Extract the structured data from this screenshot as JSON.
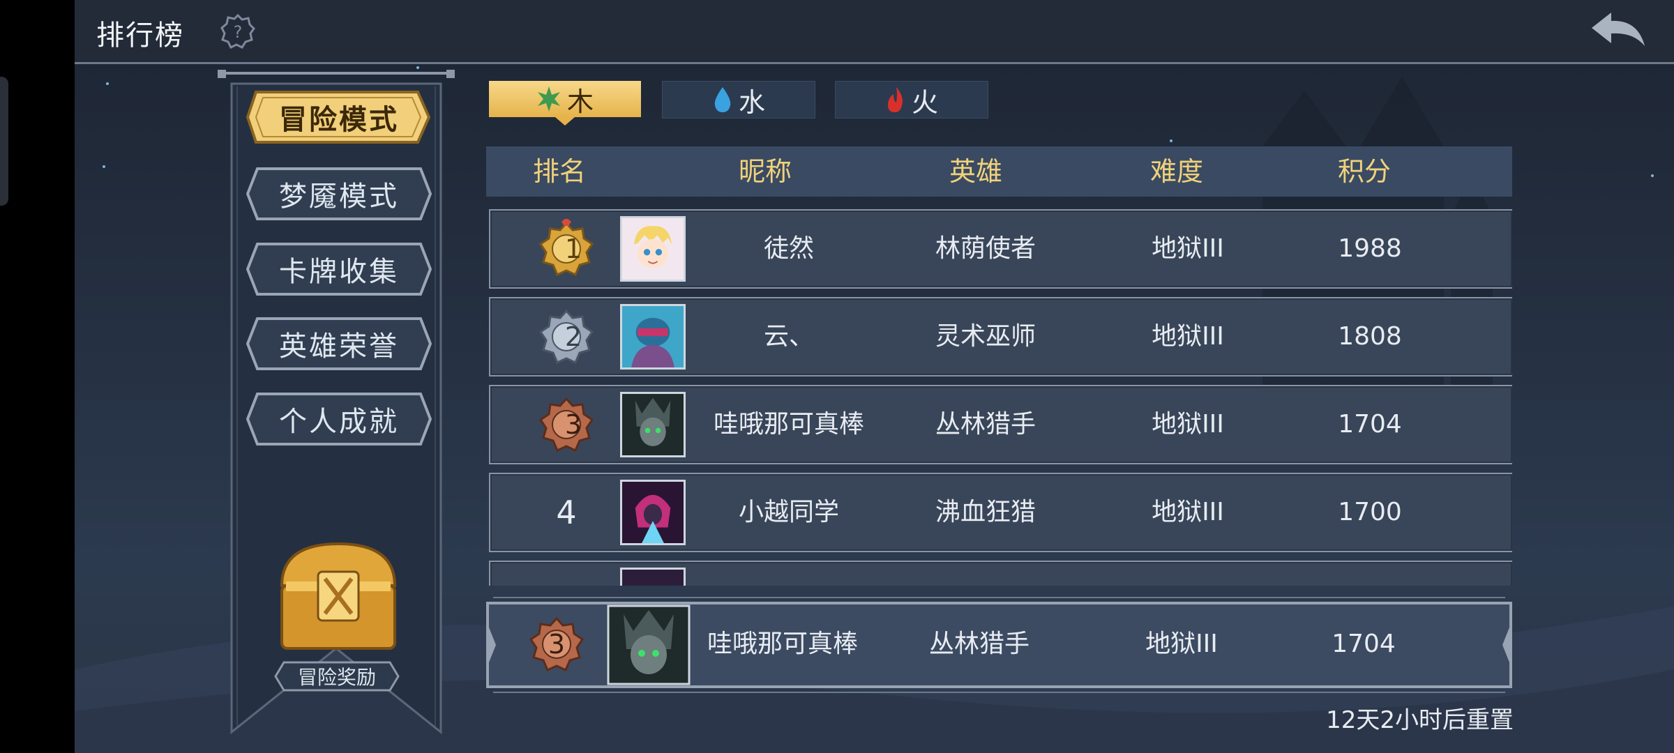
{
  "header": {
    "title": "排行榜",
    "help_icon": "help-gear-icon",
    "back_icon": "return-arrow-icon"
  },
  "modes": [
    {
      "label": "冒险模式",
      "active": true
    },
    {
      "label": "梦魇模式",
      "active": false
    },
    {
      "label": "卡牌收集",
      "active": false
    },
    {
      "label": "英雄荣誉",
      "active": false
    },
    {
      "label": "个人成就",
      "active": false
    }
  ],
  "reward": {
    "label": "冒险奖励",
    "icon": "treasure-chest-icon"
  },
  "element_tabs": [
    {
      "label": "木",
      "icon": "leaf-icon",
      "active": true
    },
    {
      "label": "水",
      "icon": "water-drop-icon",
      "active": false
    },
    {
      "label": "火",
      "icon": "flame-icon",
      "active": false
    }
  ],
  "table": {
    "headers": {
      "rank": "排名",
      "nickname": "昵称",
      "hero": "英雄",
      "difficulty": "难度",
      "score": "积分"
    },
    "rows": [
      {
        "rank": "1",
        "nickname": "徒然",
        "hero": "林荫使者",
        "difficulty": "地狱III",
        "score": "1988"
      },
      {
        "rank": "2",
        "nickname": "云、",
        "hero": "灵术巫师",
        "difficulty": "地狱III",
        "score": "1808"
      },
      {
        "rank": "3",
        "nickname": "哇哦那可真棒",
        "hero": "丛林猎手",
        "difficulty": "地狱III",
        "score": "1704"
      },
      {
        "rank": "4",
        "nickname": "小越同学",
        "hero": "沸血狂猎",
        "difficulty": "地狱III",
        "score": "1700"
      }
    ]
  },
  "my_rank": {
    "rank": "3",
    "nickname": "哇哦那可真棒",
    "hero": "丛林猎手",
    "difficulty": "地狱III",
    "score": "1704"
  },
  "reset_text": "12天2小时后重置",
  "colors": {
    "gold": "#f1d27a",
    "accent_tab": "#e6b34b",
    "panel": "#394659",
    "medal_gold": "#d9a43a",
    "medal_silver": "#9aa7b8",
    "medal_bronze": "#b5694a"
  }
}
